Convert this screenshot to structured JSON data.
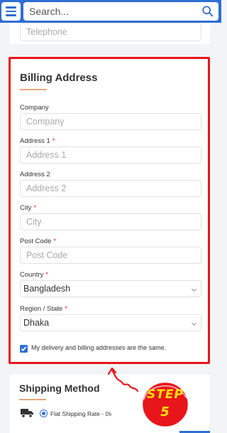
{
  "search": {
    "placeholder": "Search..."
  },
  "top_section": {
    "telephone_placeholder": "Telephone"
  },
  "billing": {
    "title": "Billing Address",
    "fields": [
      {
        "label": "Company",
        "required": false,
        "placeholder": "Company"
      },
      {
        "label": "Address 1",
        "required": true,
        "placeholder": "Address 1"
      },
      {
        "label": "Address 2",
        "required": false,
        "placeholder": "Address 2"
      },
      {
        "label": "City",
        "required": true,
        "placeholder": "City"
      },
      {
        "label": "Post Code",
        "required": true,
        "placeholder": "Post Code"
      }
    ],
    "country": {
      "label": "Country",
      "required": true,
      "value": "Bangladesh"
    },
    "region": {
      "label": "Region / State",
      "required": true,
      "value": "Dhaka"
    },
    "same_address": {
      "label": "My delivery and billing addresses are the same.",
      "checked": true
    },
    "required_mark": "*"
  },
  "shipping": {
    "title": "Shipping Method",
    "option_label": "Flat Shipping Rate - 0৳"
  },
  "annotation": {
    "line1": "STEP",
    "line2": "5"
  },
  "colors": {
    "header_blue": "#2f6fd3",
    "highlight_red": "#e8161a",
    "accent_underline": "#e6a677",
    "badge_yellow": "#ffe600"
  },
  "icons": {
    "menu": "hamburger-icon",
    "search": "search-icon",
    "select": "chevron-down-icon",
    "shipping": "truck-icon"
  }
}
